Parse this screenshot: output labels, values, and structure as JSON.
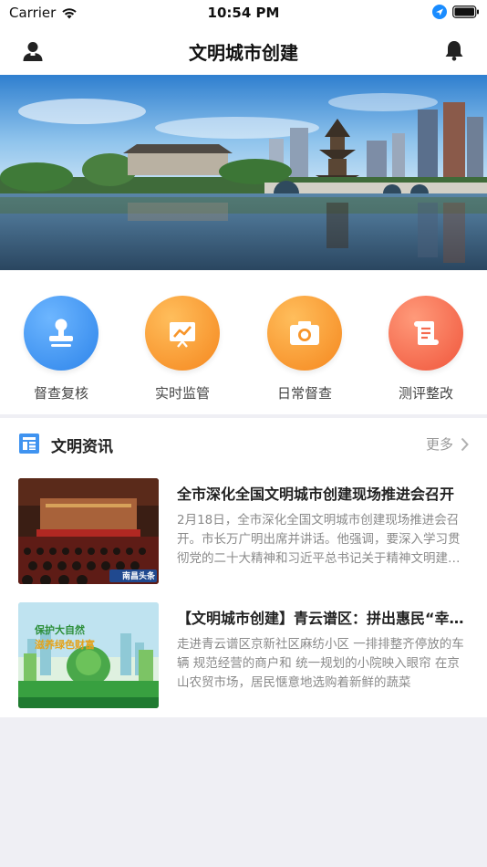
{
  "status_bar": {
    "carrier": "Carrier",
    "time": "10:54 PM"
  },
  "nav": {
    "title": "文明城市创建",
    "user_icon": "user-icon",
    "bell_icon": "bell-icon"
  },
  "quick_actions": [
    {
      "label": "督查复核",
      "icon": "stamp-icon",
      "color": "#3f93f0"
    },
    {
      "label": "实时监管",
      "icon": "chart-board-icon",
      "color": "#f7952a"
    },
    {
      "label": "日常督查",
      "icon": "camera-icon",
      "color": "#f7952a"
    },
    {
      "label": "测评整改",
      "icon": "scroll-icon",
      "color": "#f46a4e"
    }
  ],
  "news": {
    "section_title": "文明资讯",
    "more_label": "更多",
    "items": [
      {
        "title": "全市深化全国文明城市创建现场推进会召开",
        "summary": "2月18日，全市深化全国文明城市创建现场推进会召开。市长万广明出席并讲话。他强调，要深入学习贯彻党的二十大精神和习近平总书记关于精神文明建设的重要论述",
        "thumb_badge": "南昌头条"
      },
      {
        "title": "【文明城市创建】青云谱区：拼出惠民“幸福图”",
        "summary": "走进青云谱区京新社区麻纺小区  一排排整齐停放的车辆  规范经营的商户和  统一规划的小院映入眼帘  在京山农贸市场，居民惬意地选购着新鲜的蔬菜",
        "thumb_line1": "保护大自然",
        "thumb_line2": "滋养绿色财富"
      }
    ]
  },
  "colors": {
    "accent_blue": "#3f93f0",
    "accent_orange": "#f7952a",
    "accent_red": "#f46a4e"
  }
}
